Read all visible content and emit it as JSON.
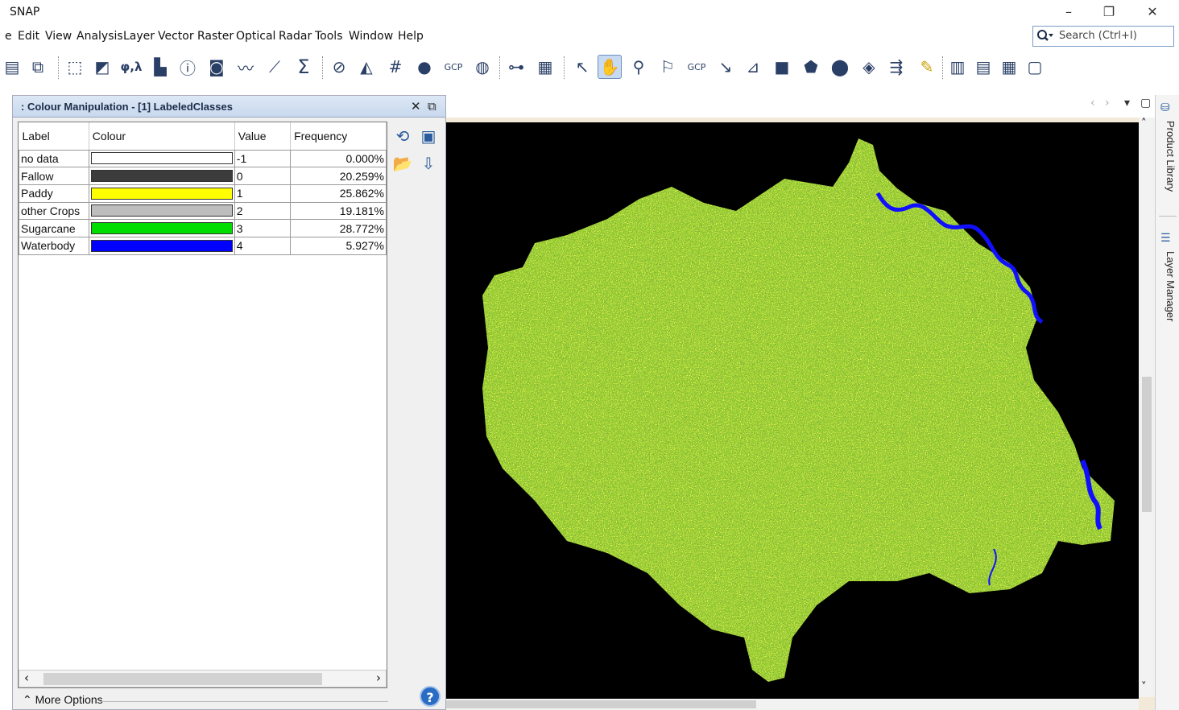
{
  "window": {
    "title": "SNAP",
    "minimize_glyph": "–",
    "restore_glyph": "❐",
    "close_glyph": "✕"
  },
  "menu": {
    "items": [
      "e",
      "Edit",
      "View",
      "Analysis",
      "Layer",
      "Vector",
      "Raster",
      "Optical",
      "Radar",
      "Tools",
      "Window",
      "Help"
    ]
  },
  "search": {
    "placeholder": "Search (Ctrl+I)",
    "icon": "magnifier-dropdown-icon"
  },
  "toolbar": {
    "icons": [
      "open-product-icon",
      "session-icon",
      "polygon-draw-icon",
      "line-draw-icon",
      "band-maths-phi-lambda-icon",
      "histogram-icon",
      "information-icon",
      "statistics-icon",
      "spectrum-icon",
      "scatter-plot-icon",
      "sum-icon",
      "mask-icon",
      "layer-icon",
      "grid-icon",
      "pixel-info-icon",
      "gcp-icon",
      "world-map-icon",
      "graph-builder-icon",
      "batch-processing-icon",
      "select-tool-icon",
      "pan-tool-icon",
      "zoom-tool-icon",
      "pin-tool-icon",
      "gcp-tool-icon",
      "draw-line-icon",
      "draw-polyline-icon",
      "draw-rectangle-icon",
      "draw-polygon-icon",
      "draw-ellipse-icon",
      "range-finder-icon",
      "magic-wand-icon",
      "pencil-icon",
      "tile-horizontal-icon",
      "tile-vertical-icon",
      "tile-grid-icon",
      "tile-single-icon"
    ],
    "gcp_label": "GCP"
  },
  "panel": {
    "title": ": Colour Manipulation - [1] LabeledClasses",
    "close_glyph": "✕",
    "float_glyph": "⧉",
    "columns": [
      "Label",
      "Colour",
      "Value",
      "Frequency"
    ],
    "rows": [
      {
        "label": "no data",
        "colour": "#ffffff",
        "value": "-1",
        "frequency": "0.000%"
      },
      {
        "label": "Fallow",
        "colour": "#3c3c3c",
        "value": "0",
        "frequency": "20.259%"
      },
      {
        "label": "Paddy",
        "colour": "#ffff00",
        "value": "1",
        "frequency": "25.862%"
      },
      {
        "label": "other Crops",
        "colour": "#bdbdbd",
        "value": "2",
        "frequency": "19.181%"
      },
      {
        "label": "Sugarcane",
        "colour": "#00dd00",
        "value": "3",
        "frequency": "28.772%"
      },
      {
        "label": "Waterbody",
        "colour": "#0000ff",
        "value": "4",
        "frequency": "5.927%"
      }
    ],
    "more_options": "More Options",
    "side_buttons": [
      "reset-icon",
      "multi-apply-icon",
      "import-icon",
      "export-icon"
    ]
  },
  "view": {
    "background": "#000000",
    "land_colors": [
      "#9acd32",
      "#b5e61d",
      "#ffff00",
      "#6bbf3a",
      "#c8c8c8",
      "#3a3a3a"
    ],
    "water_color": "#1010ff"
  },
  "sidebar": {
    "tabs": [
      "Product Library",
      "Layer Manager"
    ]
  }
}
